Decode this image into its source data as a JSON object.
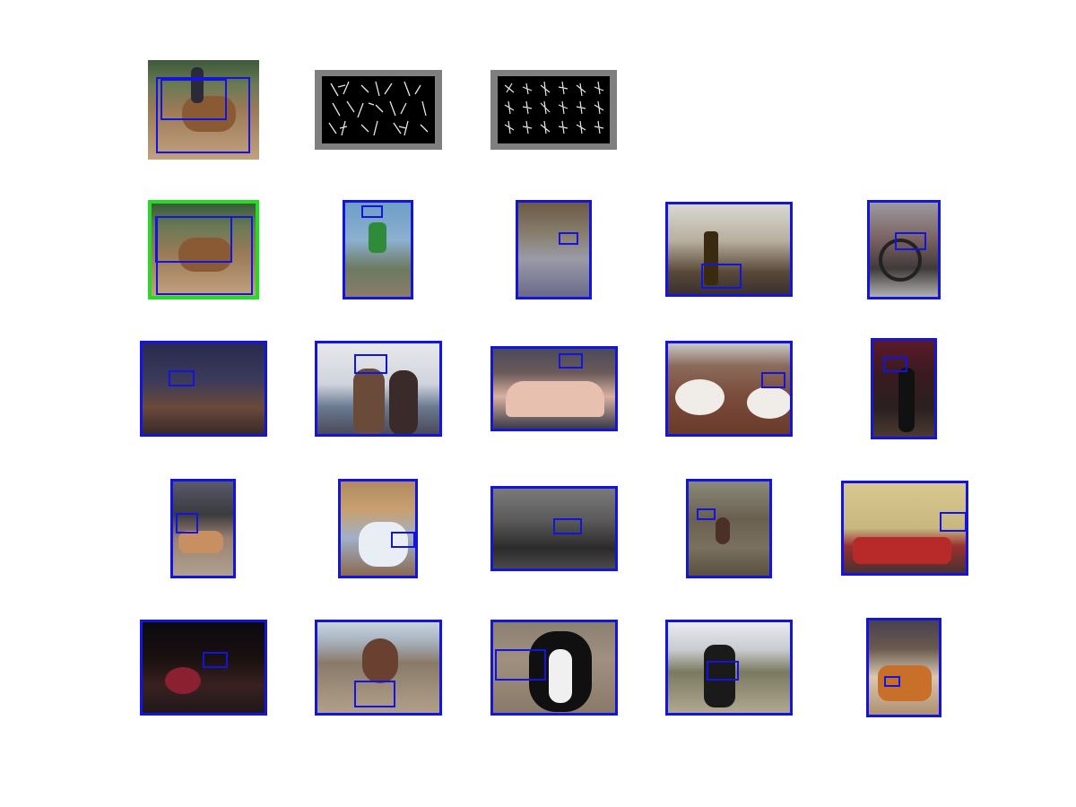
{
  "figure": {
    "query_image": "donkey-rider-photo",
    "templates": [
      "hog-template-1",
      "hog-template-2"
    ],
    "results": [
      {
        "subject": "donkey-rider",
        "selected": true
      },
      {
        "subject": "cyclist"
      },
      {
        "subject": "motorcycle-in-garage"
      },
      {
        "subject": "person-with-bottle"
      },
      {
        "subject": "motorcycle"
      },
      {
        "subject": "group-at-table"
      },
      {
        "subject": "two-women-by-sea"
      },
      {
        "subject": "pink-mini-car"
      },
      {
        "subject": "food-on-table"
      },
      {
        "subject": "woman-in-black"
      },
      {
        "subject": "dog-and-people"
      },
      {
        "subject": "woman-with-baby"
      },
      {
        "subject": "man-at-desk"
      },
      {
        "subject": "bird-in-branches"
      },
      {
        "subject": "living-room-sofa"
      },
      {
        "subject": "drummer"
      },
      {
        "subject": "woman-on-beach"
      },
      {
        "subject": "border-collie"
      },
      {
        "subject": "cow"
      },
      {
        "subject": "table-with-dishes"
      }
    ],
    "colors": {
      "detection_box": "#1414e0",
      "selected_frame": "#22dd22",
      "template_bg": "#7f7f7f"
    }
  }
}
